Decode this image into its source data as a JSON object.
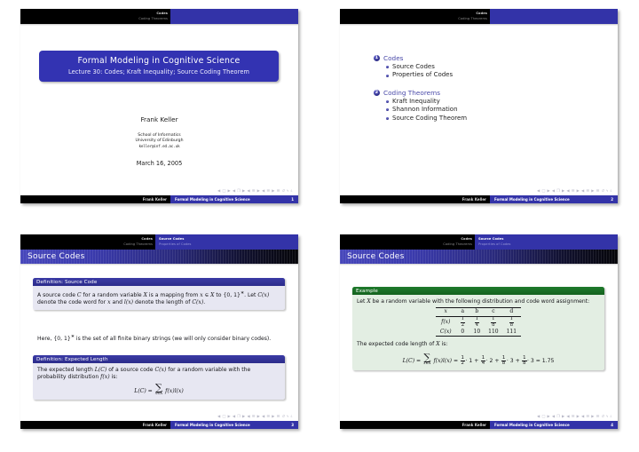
{
  "deck": {
    "author": "Frank Keller",
    "short_title": "Formal Modeling in Cognitive Science",
    "sections": [
      "Codes",
      "Coding Theorems"
    ],
    "subsections_slide34": [
      "Source Codes",
      "Properties of Codes"
    ]
  },
  "slide1": {
    "nav": {
      "sec1": "Codes",
      "sec2": "Coding Theorems"
    },
    "title": "Formal Modeling in Cognitive Science",
    "subtitle": "Lecture 30: Codes; Kraft Inequality; Source Coding Theorem",
    "author": "Frank Keller",
    "institute_line1": "School of Informatics",
    "institute_line2": "University of Edinburgh",
    "email": "keller@inf.ed.ac.uk",
    "date": "March 16, 2005",
    "footer_author": "Frank Keller",
    "footer_title": "Formal Modeling in Cognitive Science",
    "page": "1",
    "nav_symbols": "◀ □ ▶ ◀ ❐ ▶ ◀ ☰ ▶ ◀ ☰ ▶   ☰   ↺ ५ ८"
  },
  "slide2": {
    "nav": {
      "sec1": "Codes",
      "sec2": "Coding Theorems"
    },
    "outline": [
      {
        "number": "1",
        "label": "Codes",
        "items": [
          "Source Codes",
          "Properties of Codes"
        ]
      },
      {
        "number": "2",
        "label": "Coding Theorems",
        "items": [
          "Kraft Inequality",
          "Shannon Information",
          "Source Coding Theorem"
        ]
      }
    ],
    "footer_author": "Frank Keller",
    "footer_title": "Formal Modeling in Cognitive Science",
    "page": "2",
    "nav_symbols": "◀ □ ▶ ◀ ❐ ▶ ◀ ☰ ▶ ◀ ☰ ▶   ☰   ↺ ५ ८"
  },
  "slide3": {
    "nav": {
      "sec1": "Codes",
      "sec2": "Coding Theorems",
      "sub1": "Source Codes",
      "sub2": "Properties of Codes"
    },
    "frame_title": "Source Codes",
    "block1": {
      "heading": "Definition: Source Code",
      "body_1": "A source code ",
      "body_C": "C",
      "body_2": " for a random variable ",
      "body_X": "X",
      "body_3": " is a mapping from ",
      "body_xX": "x ∈ X",
      "body_4": " to {0, 1}",
      "body_star": "∗",
      "body_5": ". Let ",
      "body_Cx": "C(x)",
      "body_6": " denote the code word for ",
      "body_x": "x",
      "body_7": " and ",
      "body_lx": "l(x)",
      "body_8": " denote the length of ",
      "body_Cx2": "C(x)",
      "body_9": "."
    },
    "middle_text_1": "Here, {0, 1}",
    "middle_text_star": "∗",
    "middle_text_2": " is the set of all finite binary strings (we will only consider binary codes).",
    "block2": {
      "heading": "Definition: Expected Length",
      "body_1": "The expected length ",
      "body_LC": "L(C)",
      "body_2": " of a source code ",
      "body_Cx": "C(x)",
      "body_3": " for a random variable with the probability distribution ",
      "body_fx": "f(x)",
      "body_4": " is:",
      "formula_lhs": "L(C) =",
      "formula_sum_sub": "x∈X",
      "formula_rhs": "f(x)l(x)"
    },
    "footer_author": "Frank Keller",
    "footer_title": "Formal Modeling in Cognitive Science",
    "page": "3",
    "nav_symbols": "◀ □ ▶ ◀ ❐ ▶ ◀ ☰ ▶ ◀ ☰ ▶   ☰   ↺ ५ ८"
  },
  "slide4": {
    "nav": {
      "sec1": "Codes",
      "sec2": "Coding Theorems",
      "sub1": "Source Codes",
      "sub2": "Properties of Codes"
    },
    "frame_title": "Source Codes",
    "example": {
      "heading": "Example",
      "intro_1": "Let ",
      "intro_X": "X",
      "intro_2": " be a random variable with the following distribution and code word assignment:",
      "table": {
        "row_x": {
          "label": "x",
          "cells": [
            "a",
            "b",
            "c",
            "d"
          ]
        },
        "row_fx": {
          "label": "f(x)",
          "cells": [
            {
              "num": "1",
              "den": "2"
            },
            {
              "num": "1",
              "den": "4"
            },
            {
              "num": "1",
              "den": "8"
            },
            {
              "num": "1",
              "den": "8"
            }
          ]
        },
        "row_Cx": {
          "label": "C(x)",
          "cells": [
            "0",
            "10",
            "110",
            "111"
          ]
        }
      },
      "after_1": "The expected code length of ",
      "after_X": "X",
      "after_2": " is:",
      "formula": {
        "lhs": "L(C) =",
        "sum_sub": "x∈X",
        "mid": "f(x)l(x) =",
        "terms": [
          {
            "num": "1",
            "den": "2",
            "mult": "· 1"
          },
          {
            "num": "1",
            "den": "4",
            "mult": "· 2"
          },
          {
            "num": "1",
            "den": "8",
            "mult": "· 3"
          },
          {
            "num": "1",
            "den": "8",
            "mult": "· 3"
          }
        ],
        "plus": "+",
        "result": "= 1.75"
      }
    },
    "footer_author": "Frank Keller",
    "footer_title": "Formal Modeling in Cognitive Science",
    "page": "4",
    "nav_symbols": "◀ □ ▶ ◀ ❐ ▶ ◀ ☰ ▶ ◀ ☰ ▶   ☰   ↺ ५ ८"
  }
}
